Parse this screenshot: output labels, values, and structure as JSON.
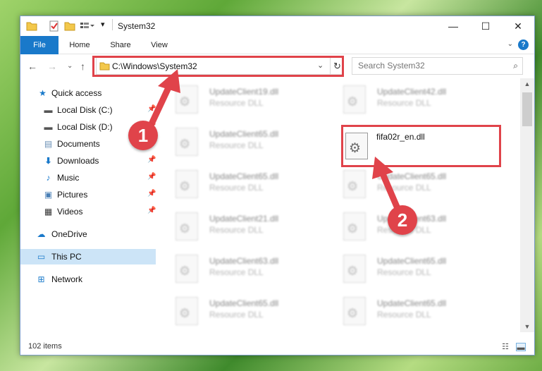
{
  "window": {
    "title": "System32",
    "controls": {
      "minimize": "—",
      "maximize": "☐",
      "close": "✕"
    }
  },
  "ribbon": {
    "tabs": [
      "File",
      "Home",
      "Share",
      "View"
    ],
    "help": "?"
  },
  "address": {
    "path": "C:\\Windows\\System32",
    "search_placeholder": "Search System32"
  },
  "sidebar": {
    "items": [
      {
        "label": "Quick access",
        "icon": "star-icon",
        "pinned": false
      },
      {
        "label": "Local Disk (C:)",
        "icon": "drive-icon",
        "pinned": true
      },
      {
        "label": "Local Disk (D:)",
        "icon": "drive-icon",
        "pinned": true
      },
      {
        "label": "Documents",
        "icon": "documents-icon",
        "pinned": true
      },
      {
        "label": "Downloads",
        "icon": "download-icon",
        "pinned": true
      },
      {
        "label": "Music",
        "icon": "music-icon",
        "pinned": true
      },
      {
        "label": "Pictures",
        "icon": "pictures-icon",
        "pinned": true
      },
      {
        "label": "Videos",
        "icon": "videos-icon",
        "pinned": true
      },
      {
        "label": "OneDrive",
        "icon": "cloud-icon",
        "pinned": false
      },
      {
        "label": "This PC",
        "icon": "computer-icon",
        "pinned": false,
        "selected": true
      },
      {
        "label": "Network",
        "icon": "network-icon",
        "pinned": false
      }
    ]
  },
  "files": [
    {
      "name": "UpdateClient19.dll",
      "type": "Resource DLL"
    },
    {
      "name": "UpdateClient42.dll",
      "type": "Resource DLL"
    },
    {
      "name": "UpdateClient65.dll",
      "type": "Resource DLL"
    },
    {
      "name": "fifa02r_en.dll",
      "type": ""
    },
    {
      "name": "UpdateClient65.dll",
      "type": "Resource DLL"
    },
    {
      "name": "UpdateClient65.dll",
      "type": "Resource DLL"
    },
    {
      "name": "UpdateClient21.dll",
      "type": "Resource DLL"
    },
    {
      "name": "UpdateClient63.dll",
      "type": "Resource DLL"
    },
    {
      "name": "UpdateClient63.dll",
      "type": "Resource DLL"
    },
    {
      "name": "UpdateClient65.dll",
      "type": "Resource DLL"
    },
    {
      "name": "UpdateClient65.dll",
      "type": "Resource DLL"
    },
    {
      "name": "UpdateClient65.dll",
      "type": "Resource DLL"
    }
  ],
  "callouts": {
    "one": "1",
    "two": "2"
  },
  "status": {
    "item_count": "102 items"
  },
  "colors": {
    "accent": "#1979ca",
    "highlight_red": "#e0434a",
    "selected_bg": "#cce4f7"
  }
}
